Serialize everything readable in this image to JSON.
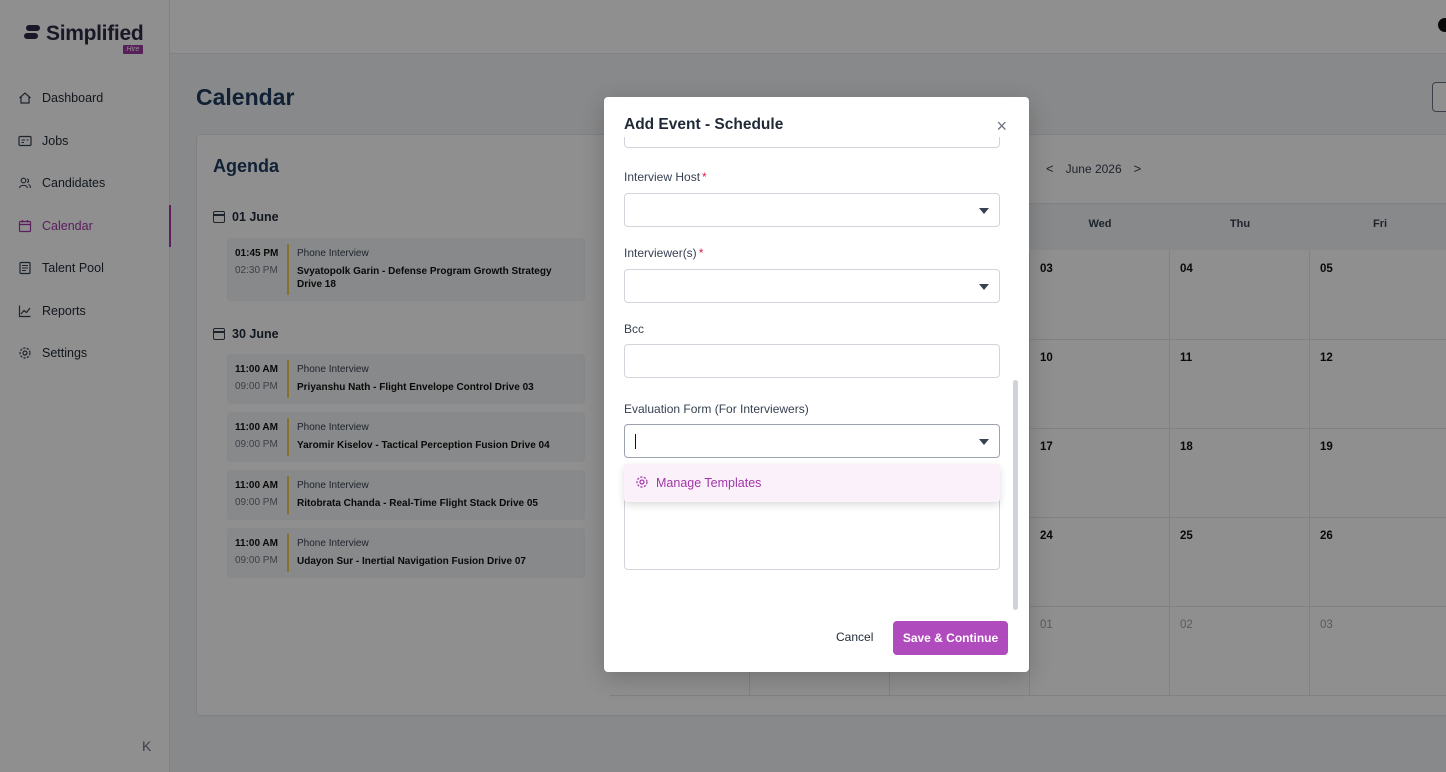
{
  "brand": {
    "name": "Simplified",
    "sub": "Hire"
  },
  "nav": [
    {
      "label": "Dashboard",
      "icon": "home-icon"
    },
    {
      "label": "Jobs",
      "icon": "id-card-icon"
    },
    {
      "label": "Candidates",
      "icon": "users-icon"
    },
    {
      "label": "Calendar",
      "icon": "calendar-icon",
      "active": true
    },
    {
      "label": "Talent Pool",
      "icon": "clipboard-icon"
    },
    {
      "label": "Reports",
      "icon": "chart-line-icon"
    },
    {
      "label": "Settings",
      "icon": "gear-icon"
    }
  ],
  "collapse_glyph": "K",
  "page": {
    "title": "Calendar"
  },
  "agenda": {
    "title": "Agenda",
    "dates": [
      "01 June",
      "30 June"
    ],
    "events": [
      {
        "start": "01:45 PM",
        "end": "02:30 PM",
        "type": "Phone Interview",
        "title": "Svyatopolk Garin - Defense Program Growth Strategy Drive 18"
      },
      {
        "start": "11:00 AM",
        "end": "09:00 PM",
        "type": "Phone Interview",
        "title": "Priyanshu Nath - Flight Envelope Control Drive 03"
      },
      {
        "start": "11:00 AM",
        "end": "09:00 PM",
        "type": "Phone Interview",
        "title": "Yaromir Kiselov - Tactical Perception Fusion Drive 04"
      },
      {
        "start": "11:00 AM",
        "end": "09:00 PM",
        "type": "Phone Interview",
        "title": "Ritobrata Chanda - Real-Time Flight Stack Drive 05"
      },
      {
        "start": "11:00 AM",
        "end": "09:00 PM",
        "type": "Phone Interview",
        "title": "Udayon Sur - Inertial Navigation Fusion Drive 07"
      }
    ]
  },
  "calendar": {
    "month_label": "June 2026",
    "prev_glyph": "<",
    "next_glyph": ">",
    "days_of_week": [
      "Wed",
      "Thu",
      "Fri"
    ],
    "rows": [
      [
        "03",
        "04",
        "05"
      ],
      [
        "10",
        "11",
        "12"
      ],
      [
        "17",
        "18",
        "19"
      ],
      [
        "24",
        "25",
        "26"
      ],
      [
        "01",
        "02",
        "03"
      ]
    ],
    "muted_row": 4
  },
  "modal": {
    "title": "Add Event - Schedule",
    "close_glyph": "×",
    "interview_host_label": "Interview Host",
    "interviewers_label": "Interviewer(s)",
    "required_mark": "*",
    "bcc_label": "Bcc",
    "evaluation_label": "Evaluation Form (For Interviewers)",
    "dropdown_option": "Manage Templates",
    "cancel": "Cancel",
    "save": "Save & Continue"
  },
  "colors": {
    "accent": "#a336a8",
    "button": "#b04bbd",
    "heading": "#1e3a5f",
    "event_bar": "#f2c94c"
  }
}
